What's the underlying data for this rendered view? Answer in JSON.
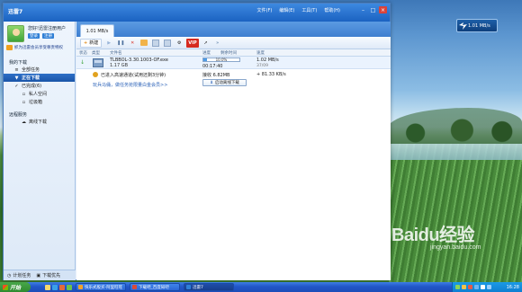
{
  "window": {
    "title": "迅雷7",
    "menu": [
      "文件(F)",
      "编辑(E)",
      "工具(T)",
      "帮助(H)"
    ],
    "controls": {
      "min": "–",
      "max": "□",
      "close": "×"
    }
  },
  "user": {
    "greeting": "您好!迅雷注册用户",
    "login": "登录",
    "register": "注册",
    "vip_promo": "抓为迅雷会员享受尊贵特权"
  },
  "sidebar": {
    "section_downloads": "我的下载",
    "items": [
      {
        "label": "全部任务",
        "icon": "list-icon"
      },
      {
        "label": "正在下载",
        "icon": "download-arrow-icon",
        "active": true
      },
      {
        "label": "已完成(6)",
        "icon": "check-icon"
      },
      {
        "label": "私人空间",
        "icon": "lock-icon"
      },
      {
        "label": "垃圾箱",
        "icon": "trash-icon"
      }
    ],
    "section_remote": "远程服务",
    "remote_items": [
      {
        "label": "离线下载",
        "icon": "cloud-icon"
      }
    ],
    "bottom": {
      "plan": "计划任务",
      "download_first": "下载优先"
    }
  },
  "tabs": [
    {
      "label": "1.01 MB/s"
    }
  ],
  "toolbar": {
    "new_label": "新建",
    "vip_label": "VIP"
  },
  "columns": {
    "status": "状态",
    "type": "类型",
    "filename": "文件名",
    "progress": "进度",
    "remaining": "剩余时间",
    "speed": "速度"
  },
  "task": {
    "filename": "TLBBOL-3.30.1003-OF.exe",
    "size": "1.17 GB",
    "progress_text": "10.0%",
    "progress_fraction": 0.1,
    "remaining": "00:17:40",
    "speed": "1.02 MB/s",
    "sub_speed": "37/09",
    "accel_message": "已进入高速通道(试用还剩3分钟)",
    "accel_link": "玩兵马俑，做任务抢限量白金会员>>",
    "received": "接收 6.82MB",
    "accel_speed": "+ 81.33 KB/s",
    "offline_button": "启动离线下载"
  },
  "float_widget": {
    "speed": "1.01 MB/s"
  },
  "watermark": {
    "main": "Baidu经验",
    "sub": "jingyan.baidu.com"
  },
  "taskbar": {
    "start": "开始",
    "tasks": [
      {
        "label": "快乐式股买-阿里旺旺",
        "color": "#f2a32b"
      },
      {
        "label": "下载吧_百度知吧",
        "color": "#d94a3a"
      },
      {
        "label": "迅雷7",
        "color": "#2e7fd8",
        "active": true
      }
    ],
    "clock": "16:28"
  }
}
